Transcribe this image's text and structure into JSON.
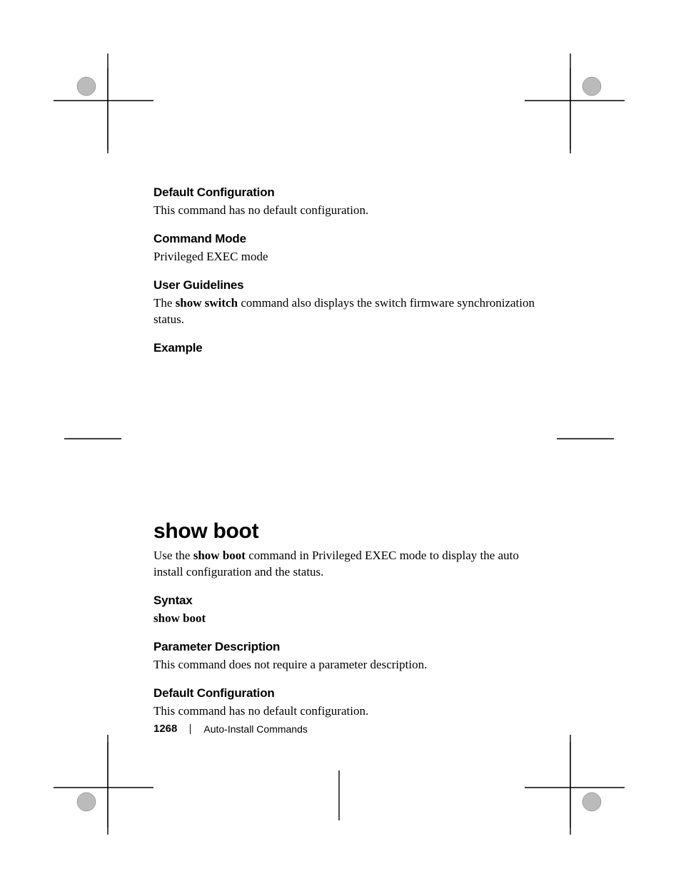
{
  "sections": {
    "defaultConfig1": {
      "heading": "Default Configuration",
      "body": "This command has no default configuration."
    },
    "commandMode": {
      "heading": "Command Mode",
      "body": "Privileged EXEC mode"
    },
    "userGuidelines": {
      "heading": "User Guidelines",
      "pre": "The ",
      "bold": "show switch",
      "post": " command also displays the switch firmware synchronization status."
    },
    "example": {
      "heading": "Example"
    },
    "command": {
      "title": "show boot",
      "intro_pre": "Use the ",
      "intro_bold": "show boot",
      "intro_post": " command in Privileged EXEC mode to display the auto install configuration and the status."
    },
    "syntax": {
      "heading": "Syntax",
      "body": "show boot"
    },
    "paramDesc": {
      "heading": "Parameter Description",
      "body": "This command does not require a parameter description."
    },
    "defaultConfig2": {
      "heading": "Default Configuration",
      "body": "This command has no default configuration."
    }
  },
  "footer": {
    "page": "1268",
    "chapter": "Auto-Install Commands"
  }
}
